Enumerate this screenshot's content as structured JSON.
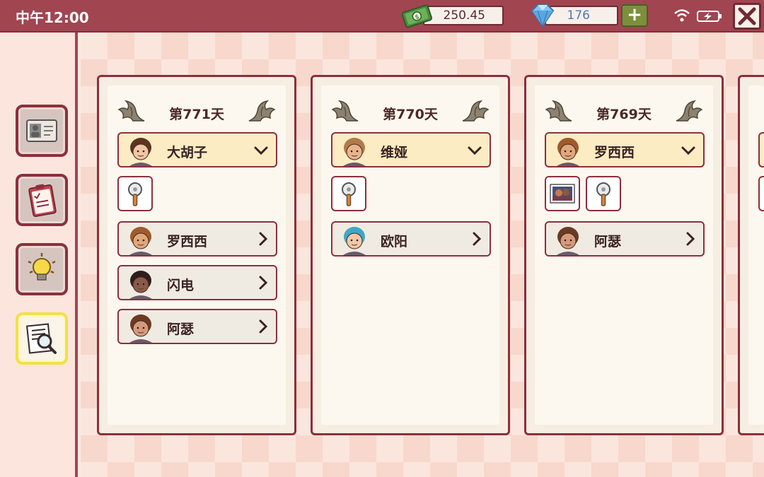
{
  "status_bar": {
    "time": "中午12:00",
    "money": "250.45",
    "gems": "176",
    "plus_label": "+"
  },
  "sidebar": {
    "items": [
      {
        "name": "id-card",
        "active": false
      },
      {
        "name": "clipboard-checklist",
        "active": false
      },
      {
        "name": "lightbulb",
        "active": false
      },
      {
        "name": "magnifier-notes",
        "active": true
      }
    ]
  },
  "cards": [
    {
      "title": "第771天",
      "selected": {
        "name": "大胡子"
      },
      "items": [
        "pizza-cutter"
      ],
      "customers": [
        {
          "name": "罗西西"
        },
        {
          "name": "闪电"
        },
        {
          "name": "阿瑟"
        }
      ]
    },
    {
      "title": "第770天",
      "selected": {
        "name": "维娅"
      },
      "items": [
        "pizza-cutter"
      ],
      "customers": [
        {
          "name": "欧阳"
        }
      ]
    },
    {
      "title": "第769天",
      "selected": {
        "name": "罗西西"
      },
      "items": [
        "photo",
        "pizza-cutter"
      ],
      "customers": [
        {
          "name": "阿瑟"
        }
      ]
    }
  ],
  "colors": {
    "topbar": "#a14551",
    "border": "#8c2f3d",
    "card_bg": "#fdf8ef",
    "selected_row": "#fcecc3",
    "plus_button": "#7d8f3d",
    "gem_text": "#5277b8"
  }
}
